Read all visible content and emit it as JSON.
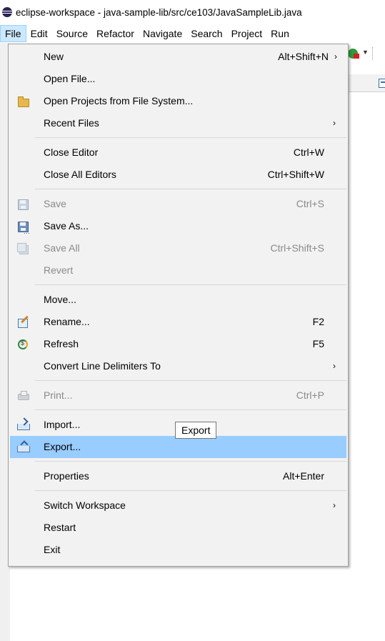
{
  "window": {
    "title": "eclipse-workspace - java-sample-lib/src/ce103/JavaSampleLib.java",
    "app_icon": "eclipse-icon"
  },
  "menubar": [
    {
      "label": "File",
      "active": true
    },
    {
      "label": "Edit"
    },
    {
      "label": "Source"
    },
    {
      "label": "Refactor"
    },
    {
      "label": "Navigate"
    },
    {
      "label": "Search"
    },
    {
      "label": "Project"
    },
    {
      "label": "Run"
    }
  ],
  "file_menu": {
    "items": [
      {
        "label": "New",
        "accel": "Alt+Shift+N",
        "submenu": true
      },
      {
        "label": "Open File..."
      },
      {
        "label": "Open Projects from File System...",
        "icon": "folder-icon"
      },
      {
        "label": "Recent Files",
        "submenu": true
      },
      {
        "label": "Close Editor",
        "accel": "Ctrl+W"
      },
      {
        "label": "Close All Editors",
        "accel": "Ctrl+Shift+W"
      },
      {
        "label": "Save",
        "accel": "Ctrl+S",
        "disabled": true,
        "icon": "save-icon"
      },
      {
        "label": "Save As...",
        "icon": "save-as-icon"
      },
      {
        "label": "Save All",
        "accel": "Ctrl+Shift+S",
        "disabled": true,
        "icon": "save-all-icon"
      },
      {
        "label": "Revert",
        "disabled": true
      },
      {
        "label": "Move..."
      },
      {
        "label": "Rename...",
        "accel": "F2",
        "icon": "rename-icon"
      },
      {
        "label": "Refresh",
        "accel": "F5",
        "icon": "refresh-icon"
      },
      {
        "label": "Convert Line Delimiters To",
        "submenu": true
      },
      {
        "label": "Print...",
        "accel": "Ctrl+P",
        "disabled": true,
        "icon": "print-icon"
      },
      {
        "label": "Import...",
        "icon": "import-icon"
      },
      {
        "label": "Export...",
        "icon": "export-icon",
        "highlighted": true
      },
      {
        "label": "Properties",
        "accel": "Alt+Enter"
      },
      {
        "label": "Switch Workspace",
        "submenu": true
      },
      {
        "label": "Restart"
      },
      {
        "label": "Exit"
      }
    ],
    "submenu_arrow": "›"
  },
  "tooltip": {
    "text": "Export"
  },
  "colors": {
    "menu_bg": "#f2f2f2",
    "highlight": "#99ccff",
    "menubar_active": "#cce8ff",
    "disabled_text": "#8a8a8a"
  }
}
